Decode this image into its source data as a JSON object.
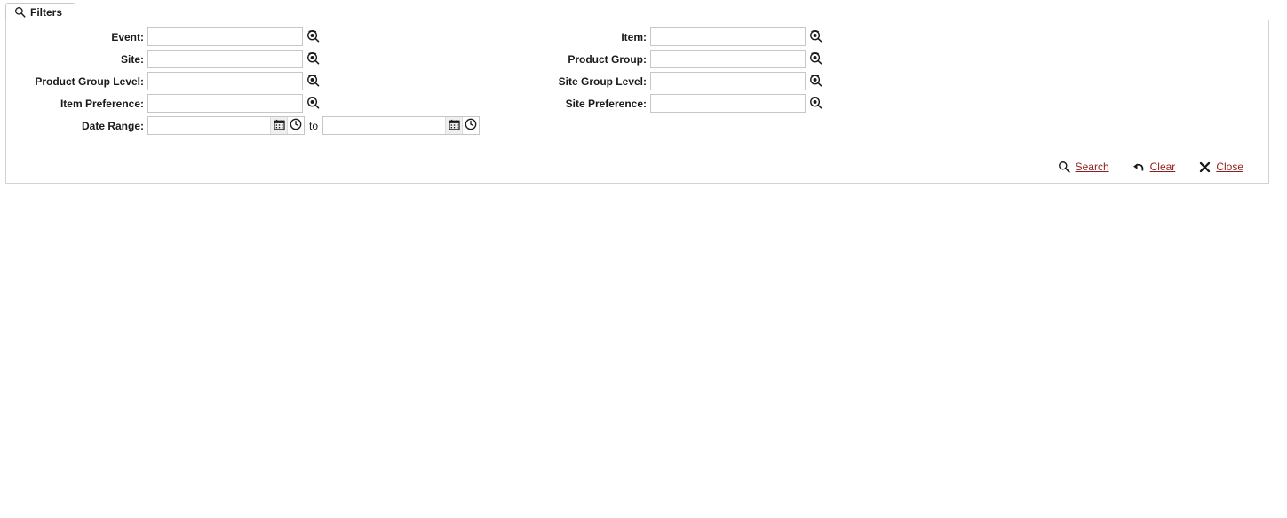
{
  "tab": {
    "label": "Filters",
    "icon": "search-icon"
  },
  "filters": {
    "left_column": [
      {
        "label": "Event:",
        "value": "",
        "placeholder": "",
        "lookup_icon": "lookup-icon",
        "type": "lookup"
      },
      {
        "label": "Site:",
        "value": "",
        "placeholder": "",
        "lookup_icon": "lookup-icon",
        "type": "lookup"
      },
      {
        "label": "Product Group Level:",
        "value": "",
        "placeholder": "",
        "lookup_icon": "lookup-icon",
        "type": "lookup"
      },
      {
        "label": "Item Preference:",
        "value": "",
        "placeholder": "",
        "lookup_icon": "lookup-icon",
        "type": "lookup"
      }
    ],
    "right_column": [
      {
        "label": "Item:",
        "value": "",
        "placeholder": "",
        "lookup_icon": "lookup-icon",
        "type": "lookup"
      },
      {
        "label": "Product Group:",
        "value": "",
        "placeholder": "",
        "lookup_icon": "lookup-icon",
        "type": "lookup"
      },
      {
        "label": "Site Group Level:",
        "value": "",
        "placeholder": "",
        "lookup_icon": "lookup-icon",
        "type": "lookup"
      },
      {
        "label": "Site Preference:",
        "value": "",
        "placeholder": "",
        "lookup_icon": "lookup-icon",
        "type": "lookup"
      }
    ],
    "date_range": {
      "label": "Date Range:",
      "from_value": "",
      "from_placeholder": "",
      "to_value": "",
      "to_placeholder": "",
      "separator": "to",
      "calendar_icon": "calendar-icon",
      "clock_icon": "clock-icon"
    }
  },
  "actions": [
    {
      "label": "Search",
      "icon": "search-icon"
    },
    {
      "label": "Clear",
      "icon": "undo-arrow-icon"
    },
    {
      "label": "Close",
      "icon": "close-x-icon"
    }
  ],
  "colors": {
    "link": "#8f1d1d",
    "label_text": "#1a1a1a",
    "panel_border": "#d2d2d2",
    "input_border": "#c6c6c6",
    "icon_button_bg": "#efefef",
    "background": "#ffffff"
  }
}
